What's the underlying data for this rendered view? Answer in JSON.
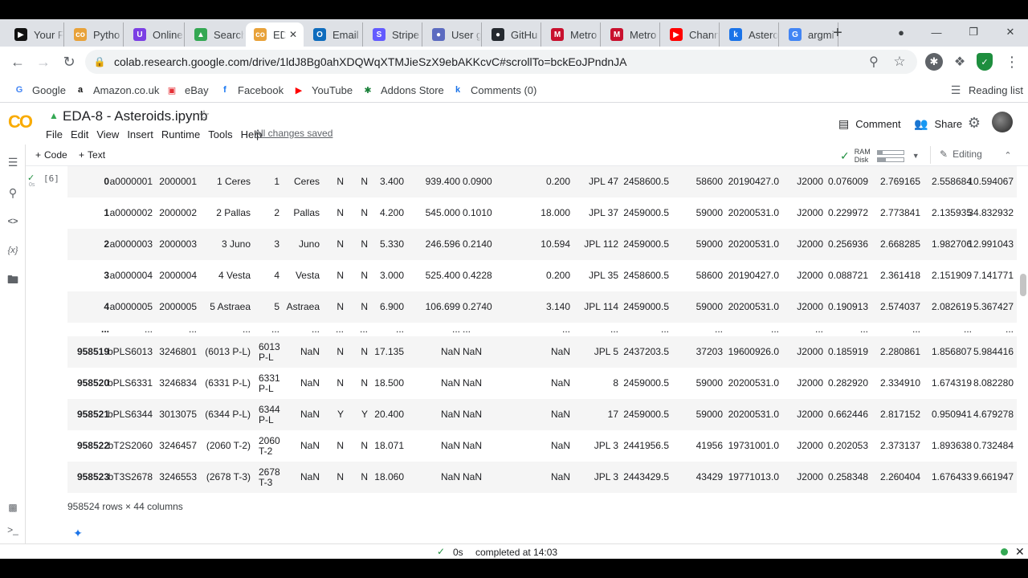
{
  "browser": {
    "tabs": [
      {
        "title": "Your F",
        "color": "#111111",
        "glyph": "▶"
      },
      {
        "title": "Pytho",
        "color": "#e8a23a",
        "glyph": "co"
      },
      {
        "title": "Online",
        "color": "#7b3fe4",
        "glyph": "U"
      },
      {
        "title": "Search",
        "color": "#34a853",
        "glyph": "▲"
      },
      {
        "title": "ED",
        "color": "#e8a23a",
        "glyph": "co"
      },
      {
        "title": "Email",
        "color": "#0f6cbd",
        "glyph": "O"
      },
      {
        "title": "Stripe",
        "color": "#635bff",
        "glyph": "S"
      },
      {
        "title": "User g",
        "color": "#5c6bc0",
        "glyph": "●"
      },
      {
        "title": "GitHu",
        "color": "#24292f",
        "glyph": "●"
      },
      {
        "title": "Metro",
        "color": "#c8102e",
        "glyph": "M"
      },
      {
        "title": "Metro",
        "color": "#c8102e",
        "glyph": "M"
      },
      {
        "title": "Chann",
        "color": "#ff0000",
        "glyph": "▶"
      },
      {
        "title": "Astero",
        "color": "#1a73e8",
        "glyph": "k"
      },
      {
        "title": "argmi",
        "color": "#4285f4",
        "glyph": "G"
      }
    ],
    "url": "colab.research.google.com/drive/1ldJ8Bg0ahXDQWqXTMJieSzX9ebAKKcvC#scrollTo=bckEoJPndnJA",
    "bookmarks": [
      {
        "label": "Google",
        "glyph": "G",
        "color": "#4285f4"
      },
      {
        "label": "Amazon.co.uk",
        "glyph": "a",
        "color": "#111111"
      },
      {
        "label": "eBay",
        "glyph": "▣",
        "color": "#e53238"
      },
      {
        "label": "Facebook",
        "glyph": "f",
        "color": "#1877f2"
      },
      {
        "label": "YouTube",
        "glyph": "▶",
        "color": "#ff0000"
      },
      {
        "label": "Addons Store",
        "glyph": "✱",
        "color": "#188038"
      },
      {
        "label": "Comments (0)",
        "glyph": "k",
        "color": "#1a73e8"
      }
    ],
    "reading_list": "Reading list"
  },
  "colab": {
    "logo": "CO",
    "notebook_title": "EDA-8 - Asteroids.ipynb",
    "menus": [
      "File",
      "Edit",
      "View",
      "Insert",
      "Runtime",
      "Tools",
      "Help"
    ],
    "saved_status": "All changes saved",
    "comment_label": "Comment",
    "share_label": "Share",
    "add_code": "Code",
    "add_text": "Text",
    "ram_label": "RAM",
    "disk_label": "Disk",
    "editing_label": "Editing",
    "exec_count": "[6]",
    "exec_time": "0s"
  },
  "table": {
    "rows": [
      {
        "idx": "0",
        "c": [
          "a0000001",
          "2000001",
          "1 Ceres",
          "1",
          "Ceres",
          "N",
          "N",
          "3.400",
          "939.400",
          "0.0900",
          "0.200",
          "JPL 47",
          "2458600.5",
          "58600",
          "20190427.0",
          "J2000",
          "0.076009",
          "2.769165",
          "2.558684",
          "10.594067"
        ]
      },
      {
        "idx": "1",
        "c": [
          "a0000002",
          "2000002",
          "2 Pallas",
          "2",
          "Pallas",
          "N",
          "N",
          "4.200",
          "545.000",
          "0.1010",
          "18.000",
          "JPL 37",
          "2459000.5",
          "59000",
          "20200531.0",
          "J2000",
          "0.229972",
          "2.773841",
          "2.135935",
          "34.832932"
        ]
      },
      {
        "idx": "2",
        "c": [
          "a0000003",
          "2000003",
          "3 Juno",
          "3",
          "Juno",
          "N",
          "N",
          "5.330",
          "246.596",
          "0.2140",
          "10.594",
          "JPL 112",
          "2459000.5",
          "59000",
          "20200531.0",
          "J2000",
          "0.256936",
          "2.668285",
          "1.982706",
          "12.991043"
        ]
      },
      {
        "idx": "3",
        "c": [
          "a0000004",
          "2000004",
          "4 Vesta",
          "4",
          "Vesta",
          "N",
          "N",
          "3.000",
          "525.400",
          "0.4228",
          "0.200",
          "JPL 35",
          "2458600.5",
          "58600",
          "20190427.0",
          "J2000",
          "0.088721",
          "2.361418",
          "2.151909",
          "7.141771"
        ]
      },
      {
        "idx": "4",
        "c": [
          "a0000005",
          "2000005",
          "5 Astraea",
          "5",
          "Astraea",
          "N",
          "N",
          "6.900",
          "106.699",
          "0.2740",
          "3.140",
          "JPL 114",
          "2459000.5",
          "59000",
          "20200531.0",
          "J2000",
          "0.190913",
          "2.574037",
          "2.082619",
          "5.367427"
        ]
      },
      {
        "idx": "...",
        "c": [
          "...",
          "...",
          "...",
          "...",
          "...",
          "...",
          "...",
          "...",
          "...",
          "...",
          "...",
          "...",
          "...",
          "...",
          "...",
          "...",
          "...",
          "...",
          "...",
          "..."
        ]
      },
      {
        "idx": "958519",
        "c": [
          "bPLS6013",
          "3246801",
          "(6013 P-L)",
          "6013\nP-L",
          "NaN",
          "N",
          "N",
          "17.135",
          "NaN",
          "NaN",
          "NaN",
          "JPL 5",
          "2437203.5",
          "37203",
          "19600926.0",
          "J2000",
          "0.185919",
          "2.280861",
          "1.856807",
          "5.984416"
        ]
      },
      {
        "idx": "958520",
        "c": [
          "bPLS6331",
          "3246834",
          "(6331 P-L)",
          "6331\nP-L",
          "NaN",
          "N",
          "N",
          "18.500",
          "NaN",
          "NaN",
          "NaN",
          "8",
          "2459000.5",
          "59000",
          "20200531.0",
          "J2000",
          "0.282920",
          "2.334910",
          "1.674319",
          "8.082280"
        ]
      },
      {
        "idx": "958521",
        "c": [
          "bPLS6344",
          "3013075",
          "(6344 P-L)",
          "6344\nP-L",
          "NaN",
          "Y",
          "Y",
          "20.400",
          "NaN",
          "NaN",
          "NaN",
          "17",
          "2459000.5",
          "59000",
          "20200531.0",
          "J2000",
          "0.662446",
          "2.817152",
          "0.950941",
          "4.679278"
        ]
      },
      {
        "idx": "958522",
        "c": [
          "bT2S2060",
          "3246457",
          "(2060 T-2)",
          "2060\nT-2",
          "NaN",
          "N",
          "N",
          "18.071",
          "NaN",
          "NaN",
          "NaN",
          "JPL 3",
          "2441956.5",
          "41956",
          "19731001.0",
          "J2000",
          "0.202053",
          "2.373137",
          "1.893638",
          "0.732484"
        ]
      },
      {
        "idx": "958523",
        "c": [
          "bT3S2678",
          "3246553",
          "(2678 T-3)",
          "2678\nT-3",
          "NaN",
          "N",
          "N",
          "18.060",
          "NaN",
          "NaN",
          "NaN",
          "JPL 3",
          "2443429.5",
          "43429",
          "19771013.0",
          "J2000",
          "0.258348",
          "2.260404",
          "1.676433",
          "9.661947"
        ]
      }
    ],
    "summary": "958524 rows × 44 columns"
  },
  "status": {
    "time": "0s",
    "message": "completed at 14:03"
  }
}
